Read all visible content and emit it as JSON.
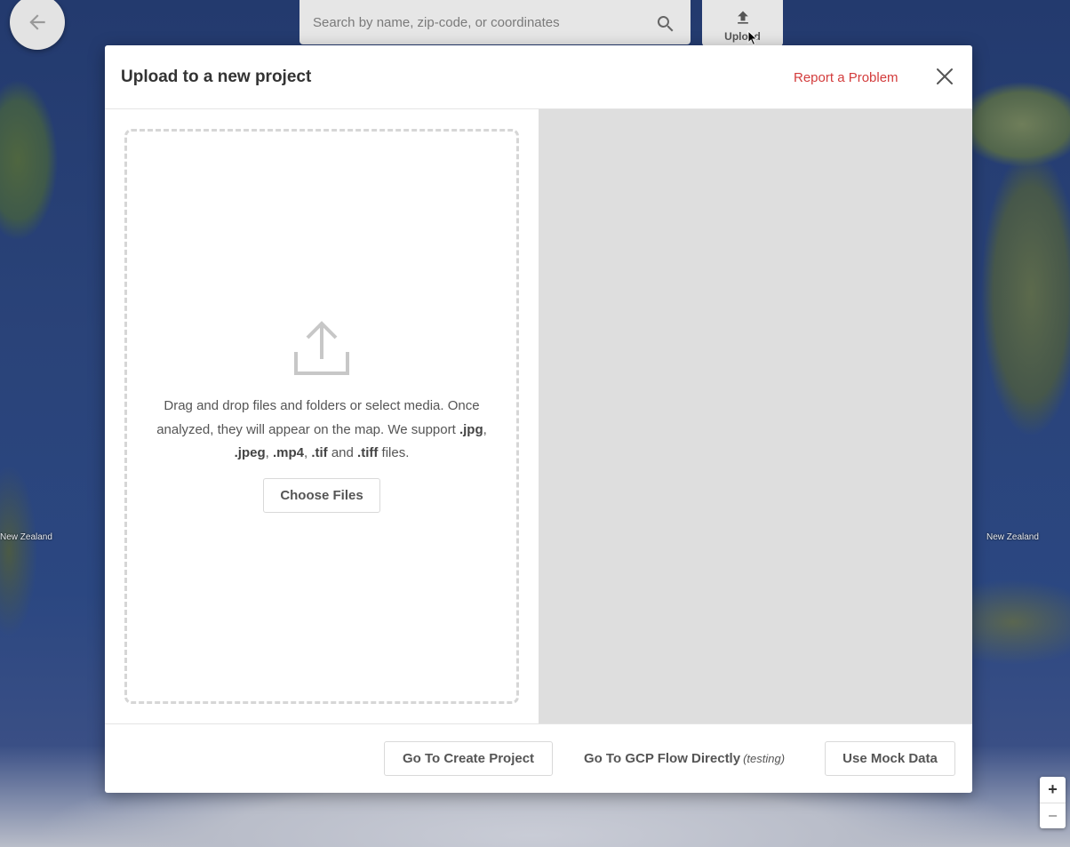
{
  "search": {
    "placeholder": "Search by name, zip-code, or coordinates"
  },
  "toolbar": {
    "upload_label": "Upload"
  },
  "map": {
    "labels": [
      "New Zealand",
      "New Zealand"
    ]
  },
  "modal": {
    "title": "Upload to a new project",
    "report_link": "Report a Problem",
    "dropzone": {
      "line1": "Drag and drop files and folders or select media. Once analyzed, they will appear on the map. We support ",
      "formats": [
        ".jpg",
        ".jpeg",
        ".mp4",
        ".tif",
        ".tiff"
      ],
      "and": "and",
      "suffix": "files.",
      "choose_button": "Choose Files"
    },
    "footer": {
      "create_project": "Go To Create Project",
      "gcp_flow": "Go To GCP Flow Directly",
      "gcp_note": "(testing)",
      "mock_data": "Use Mock Data"
    }
  },
  "zoom": {
    "in_label": "+",
    "out_label": "−"
  },
  "colors": {
    "accent_red": "#d33c3c",
    "right_pane_gray": "#dedede"
  }
}
